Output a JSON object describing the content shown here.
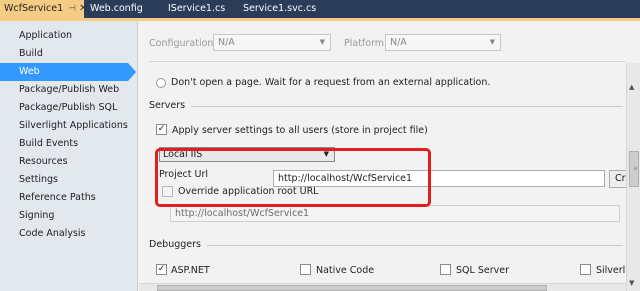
{
  "tabs": [
    {
      "label": "WcfService1",
      "active": true,
      "pin": "⊣",
      "close": "✕"
    },
    {
      "label": "Web.config"
    },
    {
      "label": "IService1.cs"
    },
    {
      "label": "Service1.svc.cs"
    }
  ],
  "sidebar": {
    "items": [
      {
        "label": "Application"
      },
      {
        "label": "Build"
      },
      {
        "label": "Web",
        "selected": true
      },
      {
        "label": "Package/Publish Web"
      },
      {
        "label": "Package/Publish SQL"
      },
      {
        "label": "Silverlight Applications"
      },
      {
        "label": "Build Events"
      },
      {
        "label": "Resources"
      },
      {
        "label": "Settings"
      },
      {
        "label": "Reference Paths"
      },
      {
        "label": "Signing"
      },
      {
        "label": "Code Analysis"
      }
    ]
  },
  "config_bar": {
    "configuration_label": "Configuration:",
    "configuration_value": "N/A",
    "platform_label": "Platform:",
    "platform_value": "N/A"
  },
  "start_action": {
    "dont_open_label": "Don't open a page.  Wait for a request from an external application."
  },
  "servers": {
    "title": "Servers",
    "apply_all_users_label": "Apply server settings to all users (store in project file)",
    "apply_all_users_checked": true,
    "server_type": "Local IIS",
    "project_url_label": "Project Url",
    "project_url_value": "http://localhost/WcfService1",
    "create_button_label": "Cre",
    "override_root_label": "Override application root URL",
    "override_root_checked": false,
    "root_url_value": "http://localhost/WcfService1"
  },
  "debuggers": {
    "title": "Debuggers",
    "items": [
      {
        "label": "ASP.NET",
        "checked": true
      },
      {
        "label": "Native Code",
        "checked": false
      },
      {
        "label": "SQL Server",
        "checked": false
      },
      {
        "label": "Silverligh",
        "checked": false
      }
    ]
  },
  "scroll_glyphs": {
    "up": "▲",
    "down": "▼",
    "grip": "≡",
    "hgrip": "|||",
    "dropdown": "▼"
  },
  "colors": {
    "tab_bar": "#2b3c59",
    "active_tab": "#f5cc84",
    "selection": "#3399ff",
    "highlight_box": "#e21f1f"
  }
}
